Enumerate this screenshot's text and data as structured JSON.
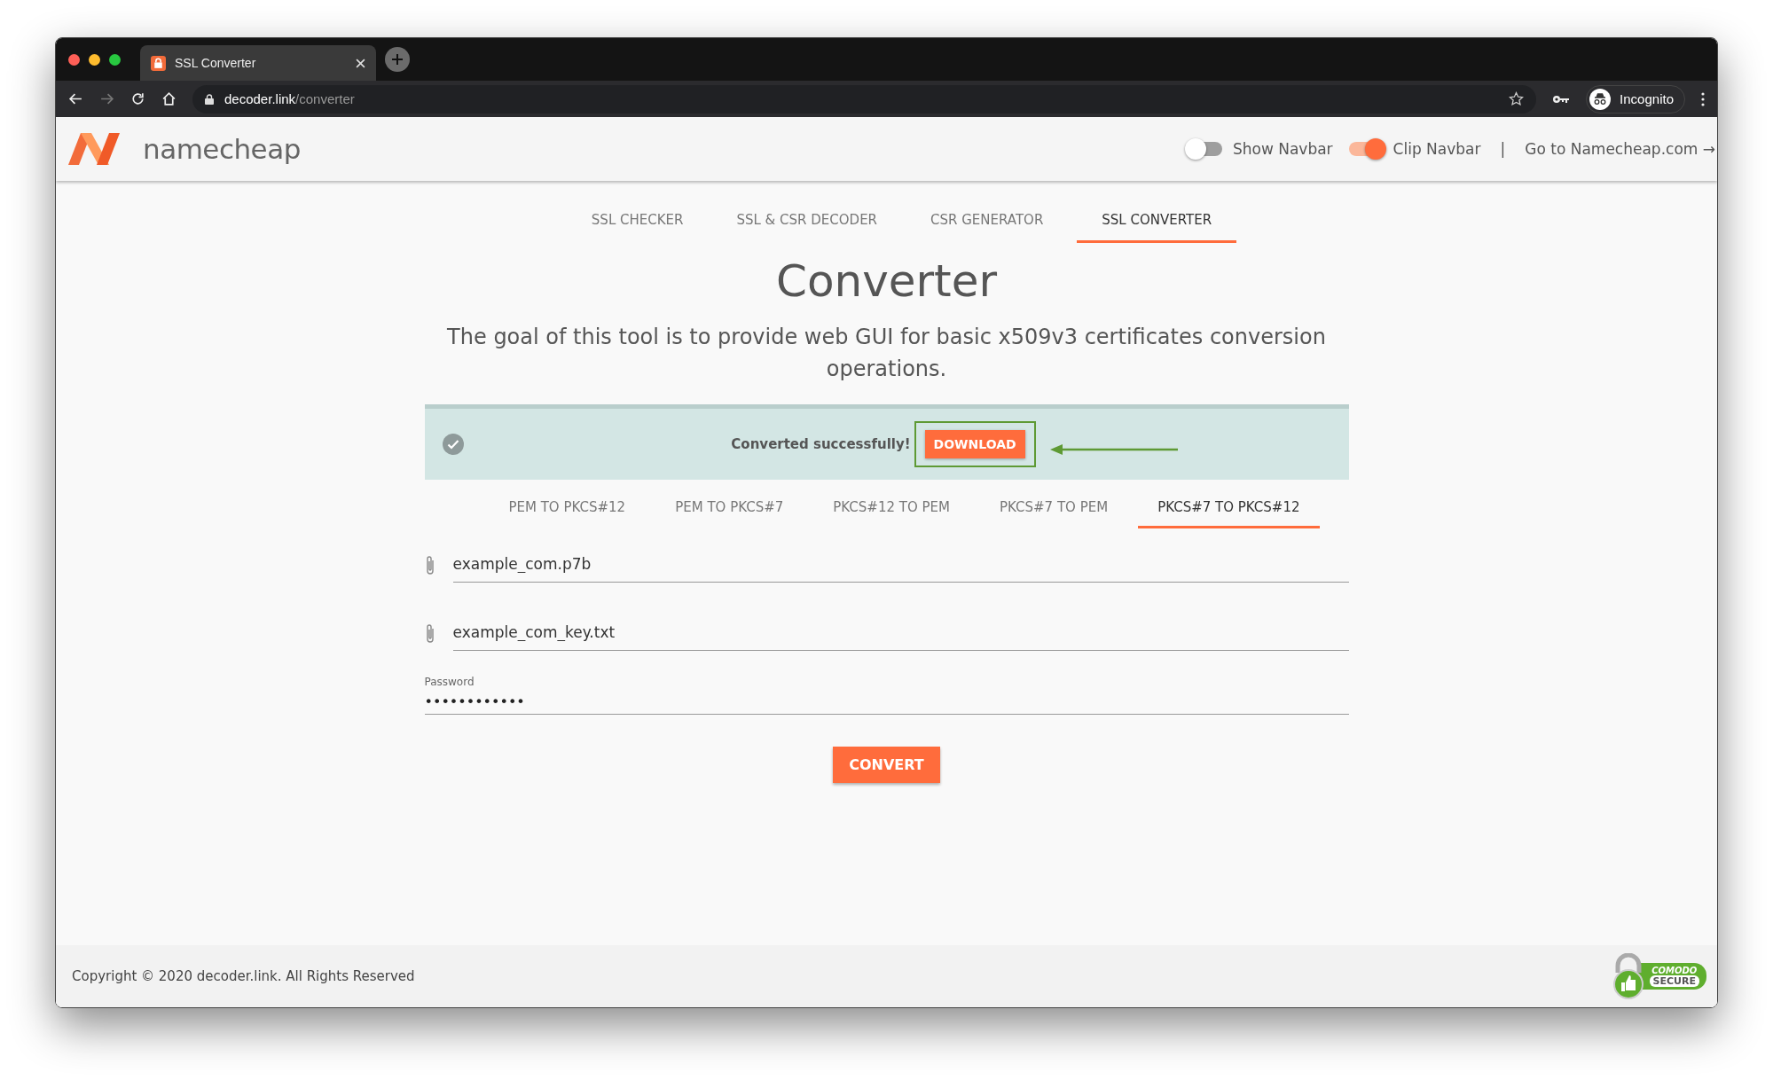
{
  "browser": {
    "tab_title": "SSL Converter",
    "url_domain": "decoder.link",
    "url_path": "/converter",
    "profile": "Incognito"
  },
  "header": {
    "logo": "namecheap",
    "toggles": [
      {
        "label": "Show Navbar",
        "on": false
      },
      {
        "label": "Clip Navbar",
        "on": true
      }
    ],
    "separator": "|",
    "link": "Go to Namecheap.com →"
  },
  "nav_tabs": [
    {
      "label": "SSL CHECKER",
      "selected": false
    },
    {
      "label": "SSL & CSR DECODER",
      "selected": false
    },
    {
      "label": "CSR GENERATOR",
      "selected": false
    },
    {
      "label": "SSL CONVERTER",
      "selected": true
    }
  ],
  "heading": "Converter",
  "description": "The goal of this tool is to provide web GUI for basic x509v3 certificates conversion operations.",
  "alert": {
    "message": "Converted successfully!",
    "button": "DOWNLOAD"
  },
  "converter_tabs": [
    {
      "label": "PEM TO PKCS#12",
      "selected": false
    },
    {
      "label": "PEM TO PKCS#7",
      "selected": false
    },
    {
      "label": "PKCS#12 TO PEM",
      "selected": false
    },
    {
      "label": "PKCS#7 TO PEM",
      "selected": false
    },
    {
      "label": "PKCS#7 TO PKCS#12",
      "selected": true
    }
  ],
  "files": [
    {
      "value": "example_com.p7b"
    },
    {
      "value": "example_com_key.txt"
    }
  ],
  "password": {
    "label": "Password",
    "value": "••••••••••••"
  },
  "convert_button": "CONVERT",
  "footer": {
    "copyright": "Copyright © 2020 decoder.link. All Rights Reserved",
    "badge_top": "COMODO",
    "badge_bottom": "SECURE"
  }
}
